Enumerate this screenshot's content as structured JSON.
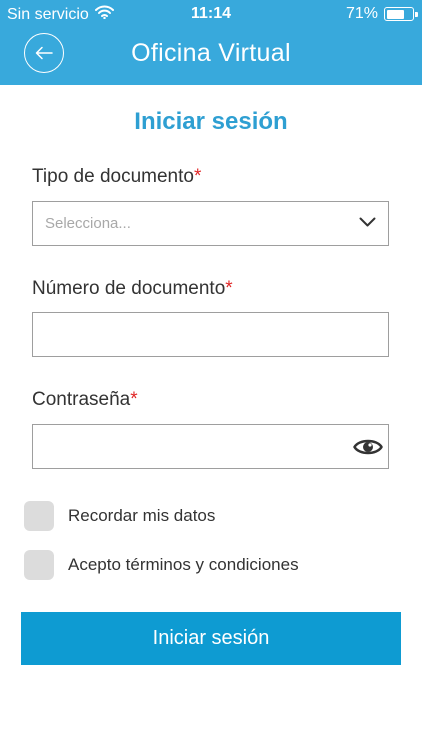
{
  "status_bar": {
    "carrier": "Sin servicio",
    "time": "11:14",
    "battery_text": "71%",
    "battery_level": 0.71
  },
  "header": {
    "title": "Oficina Virtual",
    "background_color": "#38a9dc"
  },
  "form": {
    "heading": "Iniciar sesión",
    "required_marker": "*",
    "document_type": {
      "label": "Tipo de documento",
      "selected_value": "Selecciona..."
    },
    "document_number": {
      "label": "Número de documento",
      "value": ""
    },
    "password": {
      "label": "Contraseña",
      "value": ""
    },
    "remember": {
      "label": "Recordar mis datos",
      "checked": false
    },
    "terms": {
      "label": "Acepto términos y condiciones",
      "checked": false
    },
    "submit_label": "Iniciar sesión"
  },
  "colors": {
    "accent": "#2e9fd2",
    "button": "#0e9bd2",
    "required": "#e02727"
  },
  "icons": {
    "back": "arrow-left-icon",
    "select": "chevron-down-icon",
    "password_toggle": "eye-icon",
    "wifi": "wifi-icon",
    "battery": "battery-icon"
  }
}
